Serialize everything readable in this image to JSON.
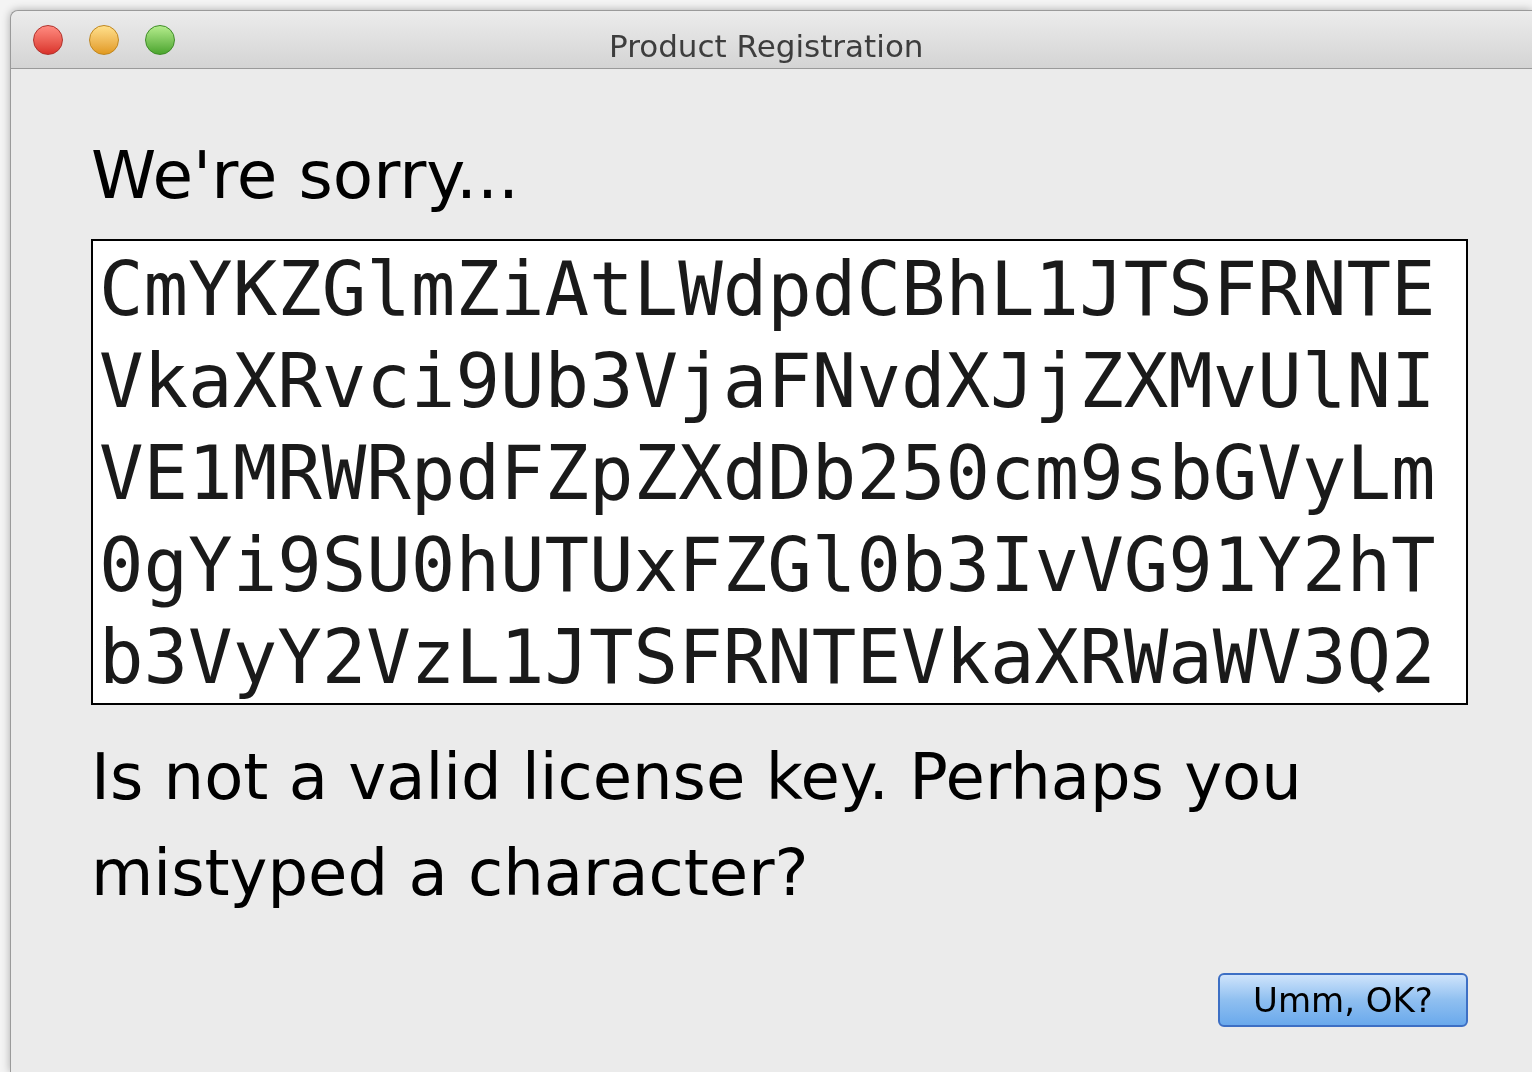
{
  "window": {
    "title": "Product Registration"
  },
  "heading": "We're sorry...",
  "key_lines": [
    "CmYKZGlmZiAtLWdpdCBhL1JTSFRNTE",
    "VkaXRvci9Ub3VjaFNvdXJjZXMvUlNI",
    "VE1MRWRpdFZpZXdDb250cm9sbGVyLm",
    "0gYi9SU0hUTUxFZGl0b3IvVG91Y2hT",
    "b3VyY2VzL1JTSFRNTEVkaXRWaWV3Q2"
  ],
  "message": "Is not a valid license key. Perhaps you mistyped a character?",
  "buttons": [
    {
      "label": "Umm, OK?",
      "default": true
    }
  ]
}
